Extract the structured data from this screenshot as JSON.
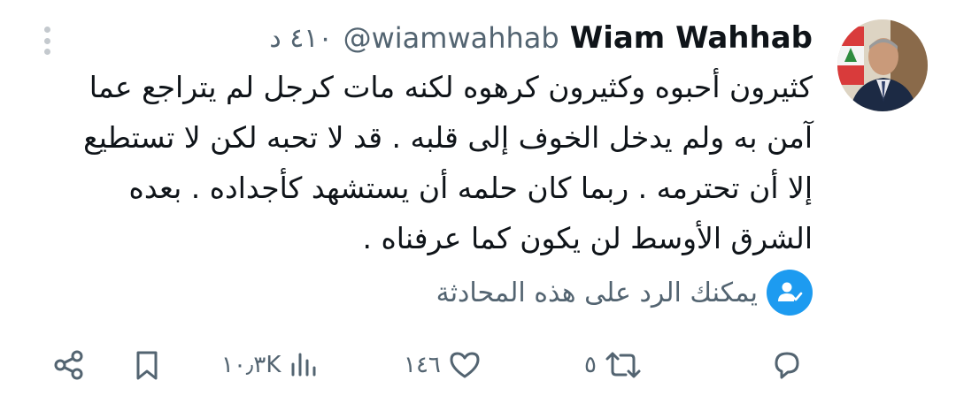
{
  "tweet": {
    "display_name": "Wiam Wahhab",
    "handle": "@wiamwahhab",
    "time": "٤١٠ د",
    "text": "كثيرون أحبوه وكثيرون كرهوه لكنه مات كرجل لم يتراجع عما آمن به ولم يدخل الخوف إلى قلبه . قد لا تحبه لكن لا تستطيع إلا أن تحترمه . ربما كان حلمه أن يستشهد كأجداده . بعده الشرق الأوسط لن يكون كما عرفناه .",
    "reply_notice": "يمكنك الرد على هذه المحادثة"
  },
  "actions": {
    "reply": {
      "icon": "reply-icon"
    },
    "retweet": {
      "icon": "retweet-icon",
      "count": "٥"
    },
    "like": {
      "icon": "heart-icon",
      "count": "١٤٦"
    },
    "views": {
      "icon": "views-icon",
      "count": "١٠٫٣K"
    },
    "bookmark": {
      "icon": "bookmark-icon"
    },
    "share": {
      "icon": "share-icon"
    }
  },
  "colors": {
    "accent": "#1d9bf0",
    "text": "#0f1419",
    "muted": "#536471"
  }
}
